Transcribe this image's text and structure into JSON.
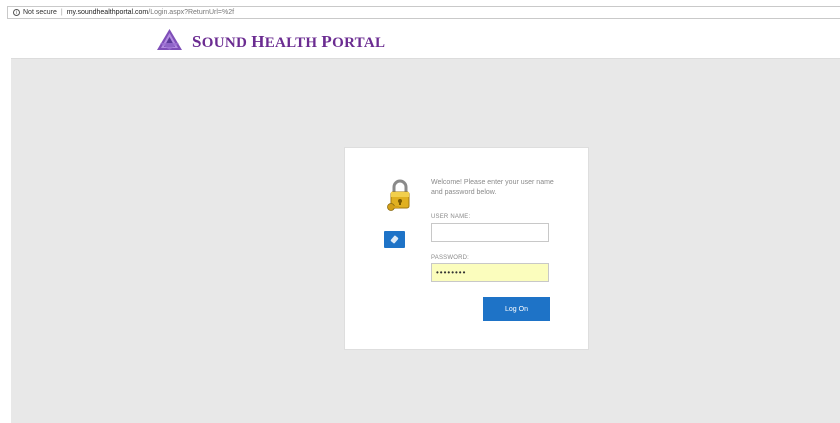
{
  "address_bar": {
    "security_label": "Not secure",
    "host": "my.soundhealthportal.com",
    "path": "/Login.aspx?ReturnUrl=%2f"
  },
  "header": {
    "brand_s1": "S",
    "brand_rest1": "OUND ",
    "brand_s2": "H",
    "brand_rest2": "EALTH ",
    "brand_s3": "P",
    "brand_rest3": "ORTAL"
  },
  "login": {
    "welcome_text": "Welcome! Please enter your user name and password below.",
    "username_label": "USER NAME:",
    "username_value": "",
    "password_label": "PASSWORD:",
    "password_value": "••••••••",
    "logon_button": "Log On"
  },
  "colors": {
    "brand": "#6b2c91",
    "button": "#1e73c7",
    "autofill": "#fbfdbd",
    "background": "#e8e8e8"
  },
  "icons": [
    "info-icon",
    "logo-icon",
    "lock-icon",
    "key-icon"
  ]
}
